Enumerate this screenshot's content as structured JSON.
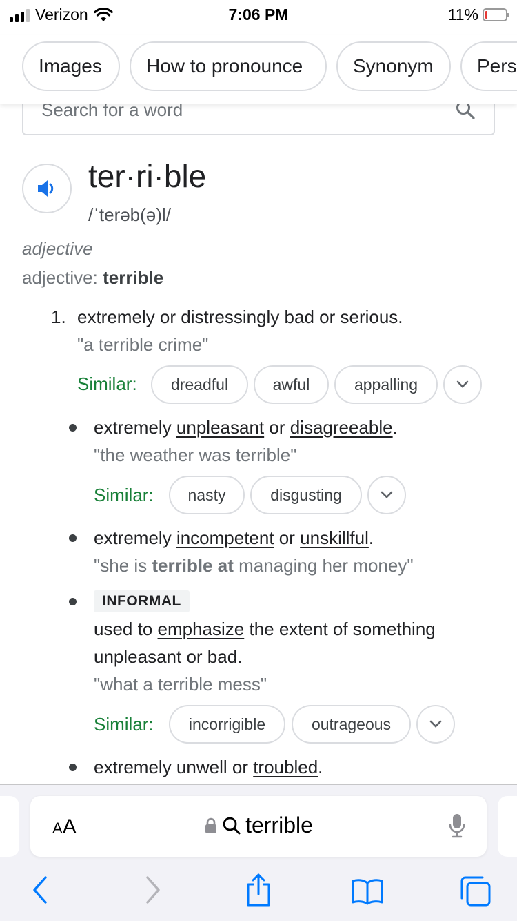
{
  "status_bar": {
    "carrier": "Verizon",
    "time": "7:06 PM",
    "battery": "11%",
    "battery_level": 0.11
  },
  "chips": [
    "Images",
    "How to pronounce",
    "Synonym",
    "Pers"
  ],
  "search": {
    "placeholder": "Search for a word"
  },
  "entry": {
    "headword": "ter·ri·ble",
    "phonetic": "/ˈterəb(ə)l/",
    "pos": "adjective",
    "pos_label": "adjective",
    "pos_word": "terrible"
  },
  "definition": {
    "number": "1.",
    "text": "extremely or distressingly bad or serious.",
    "example": "\"a terrible crime\"",
    "similar_label": "Similar:",
    "synonyms": [
      "dreadful",
      "awful",
      "appalling"
    ]
  },
  "sub1": {
    "w1": "extremely ",
    "l1": "unpleasant",
    "w2": " or ",
    "l2": "disagreeable",
    "w3": ".",
    "example": "\"the weather was terrible\"",
    "similar_label": "Similar:",
    "synonyms": [
      "nasty",
      "disgusting"
    ]
  },
  "sub2": {
    "w1": "extremely ",
    "l1": "incompetent",
    "w2": " or ",
    "l2": "unskillful",
    "w3": ".",
    "ex_a": "\"she is ",
    "ex_b": "terrible at",
    "ex_c": " managing her money\""
  },
  "sub3": {
    "badge": "INFORMAL",
    "w1": "used to ",
    "l1": "emphasize",
    "w2": " the extent of something",
    "line2": "unpleasant or bad.",
    "example": "\"what a terrible mess\"",
    "similar_label": "Similar:",
    "synonyms": [
      "incorrigible",
      "outrageous"
    ]
  },
  "sub4": {
    "w1": "extremely unwell or ",
    "l1": "troubled",
    "w2": "."
  },
  "safari": {
    "aa": "A",
    "aa_big": "A",
    "url": "terrible"
  },
  "colors": {
    "accent_blue": "#1a73e8",
    "similar_green": "#188038",
    "ios_blue": "#007aff"
  }
}
